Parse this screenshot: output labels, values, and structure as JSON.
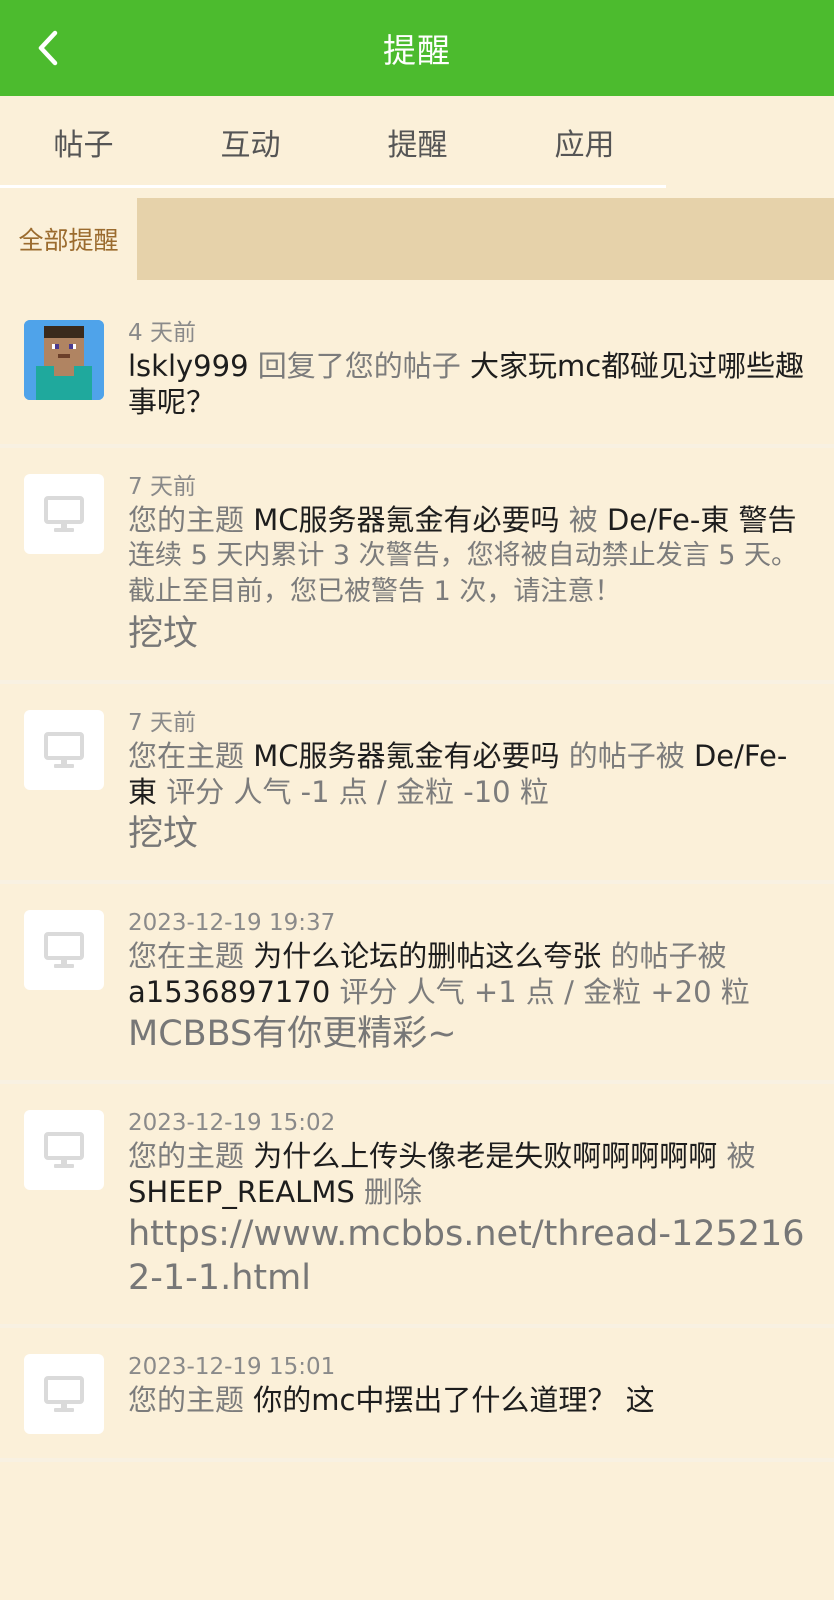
{
  "header": {
    "title": "提醒"
  },
  "tabs": [
    {
      "label": "帖子"
    },
    {
      "label": "互动"
    },
    {
      "label": "提醒"
    },
    {
      "label": "应用"
    }
  ],
  "filter": {
    "label": "全部提醒"
  },
  "notifications": [
    {
      "time": "4 天前",
      "user": "lskly999",
      "action": "回复了您的帖子",
      "thread": "大家玩mc都碰见过哪些趣事呢？"
    },
    {
      "time": "7 天前",
      "prefix": "您的主题",
      "thread": "MC服务器氪金有必要吗",
      "by": "被",
      "actor": "De/Fe-東",
      "action": "警告",
      "note1": "连续 5 天内累计 3 次警告，您将被自动禁止发言 5 天。",
      "note2": "截止至目前，您已被警告 1 次，请注意！",
      "reason": "挖坟"
    },
    {
      "time": "7 天前",
      "prefix": "您在主题",
      "thread": "MC服务器氪金有必要吗",
      "mid": "的帖子被",
      "actor": "De/Fe-東",
      "rating": "评分 人气 -1 点 / 金粒 -10 粒",
      "reason": "挖坟"
    },
    {
      "time": "2023-12-19 19:37",
      "prefix": "您在主题",
      "thread": "为什么论坛的删帖这么夸张",
      "mid": "的帖子被",
      "actor": "a1536897170",
      "rating": "评分 人气 +1 点 / 金粒 +20 粒",
      "reason": "MCBBS有你更精彩~"
    },
    {
      "time": "2023-12-19 15:02",
      "prefix": "您的主题",
      "thread": "为什么上传头像老是失败啊啊啊啊啊",
      "by": "被",
      "actor": "SHEEP_REALMS",
      "action": "删除",
      "reason": "https://www.mcbbs.net/thread-1252162-1-1.html"
    },
    {
      "time": "2023-12-19 15:01",
      "prefix": "您的主题",
      "thread": "你的mc中摆出了什么道理？ 这"
    }
  ],
  "colors": {
    "accent": "#4CBB2E",
    "background": "#FBF0D9",
    "filter_fill": "#E6D2AA"
  }
}
